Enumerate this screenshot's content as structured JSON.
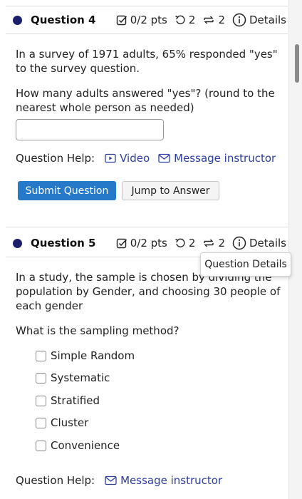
{
  "colors": {
    "accent": "#2679c9",
    "link": "#2c3ea0",
    "dot": "#1b1f6b"
  },
  "question4": {
    "title": "Question 4",
    "pts": "0/2 pts",
    "retries": "2",
    "attempts": "2",
    "details": "Details",
    "text1": "In a survey of 1971 adults, 65% responded \"yes\" to the survey question.",
    "text2": "How many adults answered \"yes\"? (round to the nearest whole person as needed)",
    "answer_value": "",
    "help_label": "Question Help:",
    "video_link": "Video",
    "message_link": "Message instructor",
    "submit_button": "Submit Question",
    "jump_button": "Jump to Answer"
  },
  "question5": {
    "title": "Question 5",
    "pts": "0/2 pts",
    "retries": "2",
    "attempts": "2",
    "details": "Details",
    "tooltip": "Question Details",
    "text1": "In a study, the sample is chosen by dividing the population by Gender, and choosing 30 people of each gender",
    "text2": "What is the sampling method?",
    "options": [
      "Simple Random",
      "Systematic",
      "Stratified",
      "Cluster",
      "Convenience"
    ],
    "help_label": "Question Help:",
    "message_link": "Message instructor"
  }
}
